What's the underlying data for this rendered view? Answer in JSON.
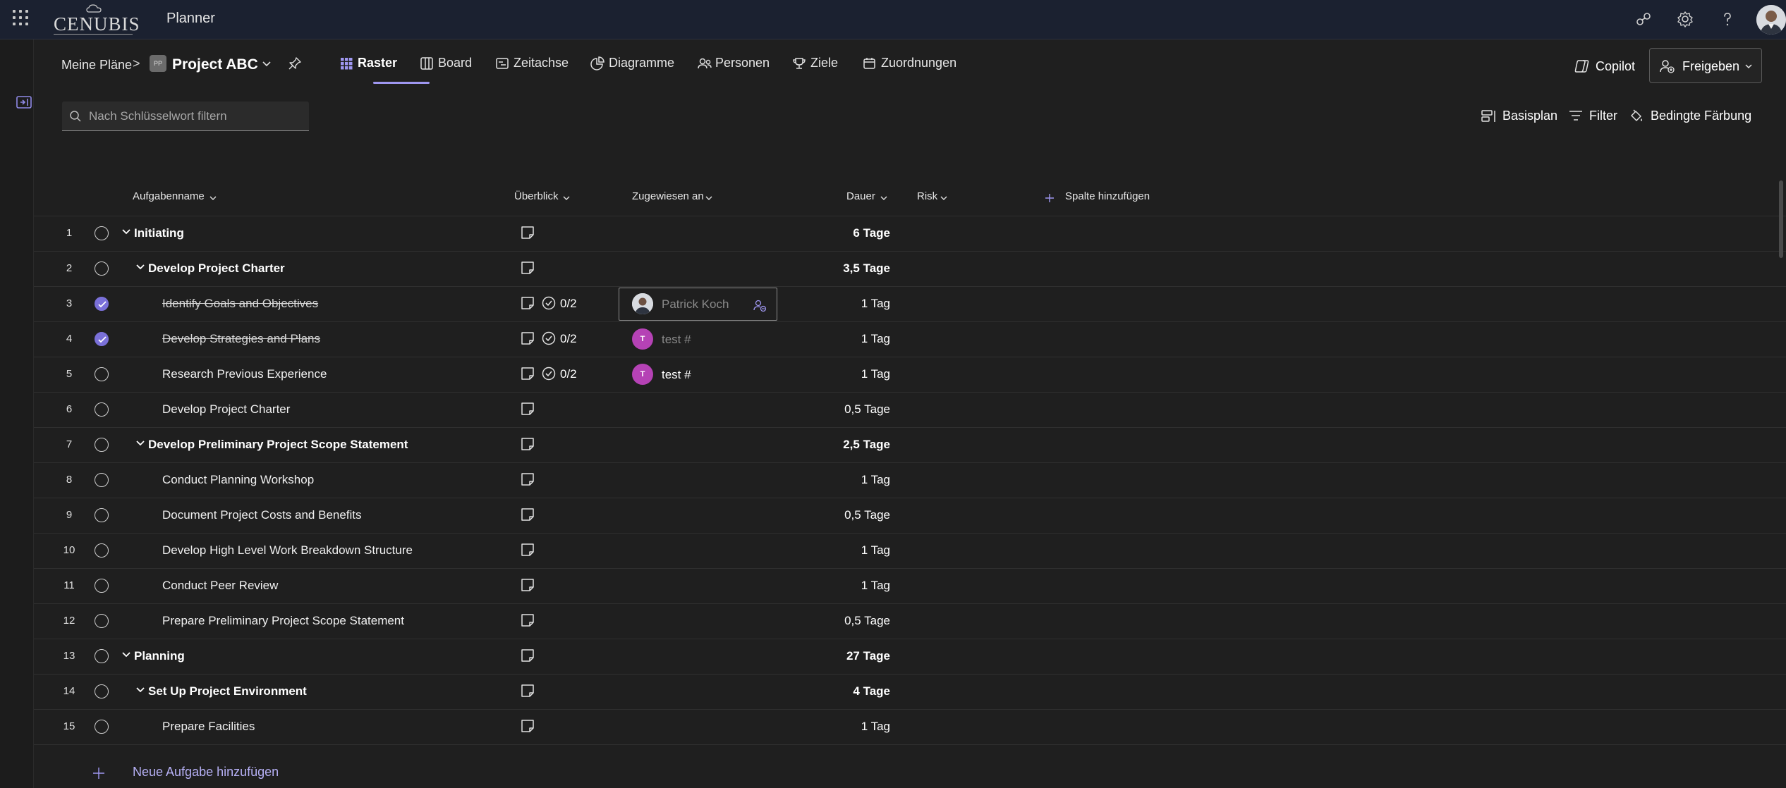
{
  "appbar": {
    "logo_text": "CENUBIS",
    "app_name": "Planner",
    "icons": [
      "apps-grid-icon",
      "share-network-icon",
      "settings-gear-icon",
      "help-question-icon",
      "user-avatar"
    ]
  },
  "header": {
    "breadcrumb_home": "Meine Pläne",
    "breadcrumb_separator": ">",
    "plan_icon_text": "PP",
    "plan_name": "Project ABC",
    "tabs": [
      {
        "label": "Raster",
        "icon": "grid-icon",
        "active": true
      },
      {
        "label": "Board",
        "icon": "board-icon",
        "active": false
      },
      {
        "label": "Zeitachse",
        "icon": "timeline-icon",
        "active": false
      },
      {
        "label": "Diagramme",
        "icon": "charts-icon",
        "active": false
      },
      {
        "label": "Personen",
        "icon": "people-icon",
        "active": false
      },
      {
        "label": "Ziele",
        "icon": "trophy-icon",
        "active": false
      },
      {
        "label": "Zuordnungen",
        "icon": "assignments-icon",
        "active": false
      }
    ],
    "copilot_label": "Copilot",
    "share_label": "Freigeben"
  },
  "filterbar": {
    "search_placeholder": "Nach Schlüsselwort filtern",
    "search_value": "",
    "baseline_label": "Basisplan",
    "filter_label": "Filter",
    "conditional_label": "Bedingte Färbung"
  },
  "grid": {
    "columns": {
      "task_name": "Aufgabenname",
      "overview": "Überblick",
      "assigned_to": "Zugewiesen an",
      "duration": "Dauer",
      "risk": "Risk",
      "add_column": "Spalte hinzufügen"
    },
    "rows": [
      {
        "num": "1",
        "name": "Initiating",
        "level": 0,
        "summary": true,
        "done": false,
        "checklist": "",
        "assignee": "",
        "duration": "6 Tage"
      },
      {
        "num": "2",
        "name": "Develop Project Charter",
        "level": 1,
        "summary": true,
        "done": false,
        "checklist": "",
        "assignee": "",
        "duration": "3,5 Tage"
      },
      {
        "num": "3",
        "name": "Identify Goals and Objectives",
        "level": 2,
        "summary": false,
        "done": true,
        "checklist": "0/2",
        "assignee": "Patrick Koch",
        "assignee_type": "photo",
        "selected": true,
        "duration": "1 Tag"
      },
      {
        "num": "4",
        "name": "Develop Strategies and Plans",
        "level": 2,
        "summary": false,
        "done": true,
        "checklist": "0/2",
        "assignee": "test #",
        "assignee_initial": "T",
        "assignee_type": "initial",
        "duration": "1 Tag"
      },
      {
        "num": "5",
        "name": "Research Previous Experience",
        "level": 2,
        "summary": false,
        "done": false,
        "checklist": "0/2",
        "assignee": "test #",
        "assignee_initial": "T",
        "assignee_type": "initial",
        "duration": "1 Tag"
      },
      {
        "num": "6",
        "name": "Develop Project Charter",
        "level": 2,
        "summary": false,
        "done": false,
        "checklist": "",
        "assignee": "",
        "duration": "0,5 Tage"
      },
      {
        "num": "7",
        "name": "Develop Preliminary Project Scope Statement",
        "level": 1,
        "summary": true,
        "done": false,
        "checklist": "",
        "assignee": "",
        "duration": "2,5 Tage"
      },
      {
        "num": "8",
        "name": "Conduct Planning Workshop",
        "level": 2,
        "summary": false,
        "done": false,
        "checklist": "",
        "assignee": "",
        "duration": "1 Tag"
      },
      {
        "num": "9",
        "name": "Document Project Costs and Benefits",
        "level": 2,
        "summary": false,
        "done": false,
        "checklist": "",
        "assignee": "",
        "duration": "0,5 Tage"
      },
      {
        "num": "10",
        "name": "Develop High Level Work Breakdown Structure",
        "level": 2,
        "summary": false,
        "done": false,
        "checklist": "",
        "assignee": "",
        "duration": "1 Tag"
      },
      {
        "num": "11",
        "name": "Conduct Peer Review",
        "level": 2,
        "summary": false,
        "done": false,
        "checklist": "",
        "assignee": "",
        "duration": "1 Tag"
      },
      {
        "num": "12",
        "name": "Prepare Preliminary Project Scope Statement",
        "level": 2,
        "summary": false,
        "done": false,
        "checklist": "",
        "assignee": "",
        "duration": "0,5 Tage"
      },
      {
        "num": "13",
        "name": "Planning",
        "level": 0,
        "summary": true,
        "done": false,
        "checklist": "",
        "assignee": "",
        "duration": "27 Tage"
      },
      {
        "num": "14",
        "name": "Set Up Project Environment",
        "level": 1,
        "summary": true,
        "done": false,
        "checklist": "",
        "assignee": "",
        "duration": "4 Tage"
      },
      {
        "num": "15",
        "name": "Prepare Facilities",
        "level": 2,
        "summary": false,
        "done": false,
        "checklist": "",
        "assignee": "",
        "duration": "1 Tag"
      }
    ],
    "add_task_label": "Neue Aufgabe hinzufügen"
  },
  "colors": {
    "accent": "#9f97f0",
    "check_done": "#7a70d8",
    "avatar_pink": "#b542b5",
    "topbar": "#1b2130",
    "background": "#1f1f1f"
  }
}
